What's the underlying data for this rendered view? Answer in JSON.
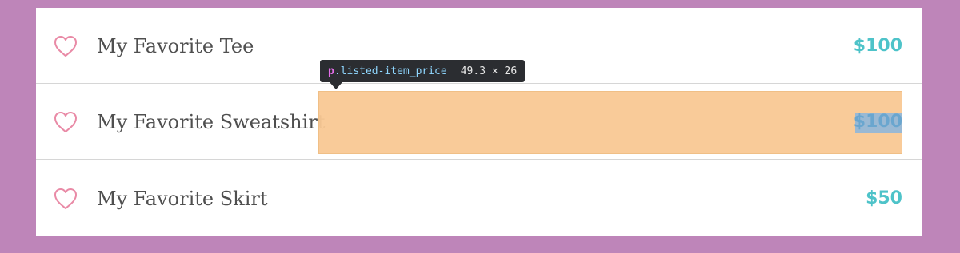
{
  "colors": {
    "background": "#be85b9",
    "panel": "#ffffff",
    "price": "#4ec3c9",
    "heart": "#e98aa6",
    "name_text": "#4f4f4f",
    "highlight": "#f9c894",
    "tooltip_bg": "#2b2d31"
  },
  "items": [
    {
      "name": "My Favorite Tee",
      "price": "$100",
      "icon": "heart-outline-icon"
    },
    {
      "name": "My Favorite Sweatshirt",
      "price": "$100",
      "icon": "heart-outline-icon"
    },
    {
      "name": "My Favorite Skirt",
      "price": "$50",
      "icon": "heart-outline-icon"
    }
  ],
  "inspector": {
    "tag": "p",
    "class_name": ".listed-item_price",
    "dimensions": "49.3 × 26"
  }
}
